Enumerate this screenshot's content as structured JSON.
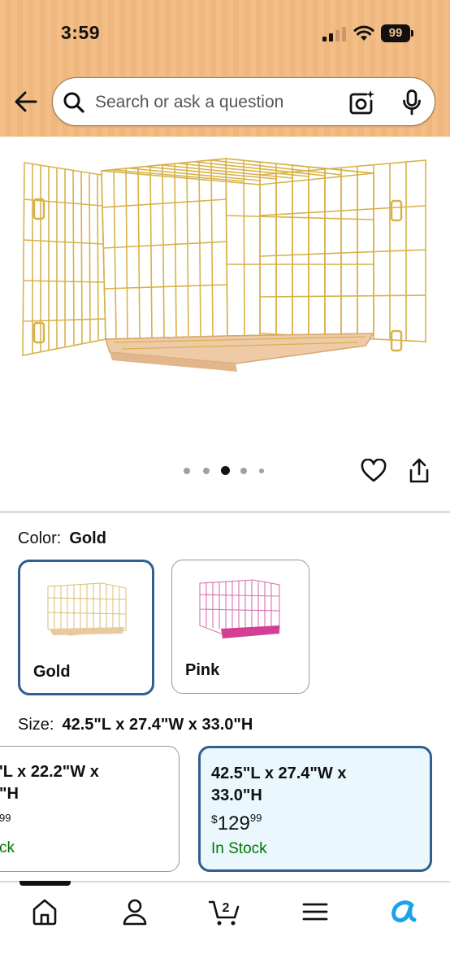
{
  "status": {
    "time": "3:59",
    "battery": "99"
  },
  "search": {
    "placeholder": "Search or ask a question"
  },
  "carousel": {
    "total": 5,
    "active": 2
  },
  "color": {
    "label": "Color:",
    "selected": "Gold",
    "options": [
      {
        "name": "Gold",
        "selected": true
      },
      {
        "name": "Pink",
        "selected": false
      }
    ]
  },
  "size": {
    "label": "Size:",
    "selected": "42.5\"L x 27.4\"W x 33.0\"H",
    "options": [
      {
        "line1": "'L x 22.2\"W x",
        "line2": "\"H",
        "price_tail": "99",
        "stock": "ck",
        "selected": false
      },
      {
        "line1": "42.5\"L x 27.4\"W x",
        "line2": "33.0\"H",
        "currency": "$",
        "price_whole": "129",
        "price_frac": "99",
        "stock": "In Stock",
        "selected": true
      }
    ]
  },
  "nav": {
    "items": [
      "home-icon",
      "account-icon",
      "cart-icon",
      "menu-icon",
      "rufus-icon"
    ],
    "cart_count": "2"
  },
  "colors": {
    "header": "#f2bd86",
    "selected_border": "#2e5f8f",
    "in_stock": "#007600",
    "rufus": "#1aa3e8"
  }
}
